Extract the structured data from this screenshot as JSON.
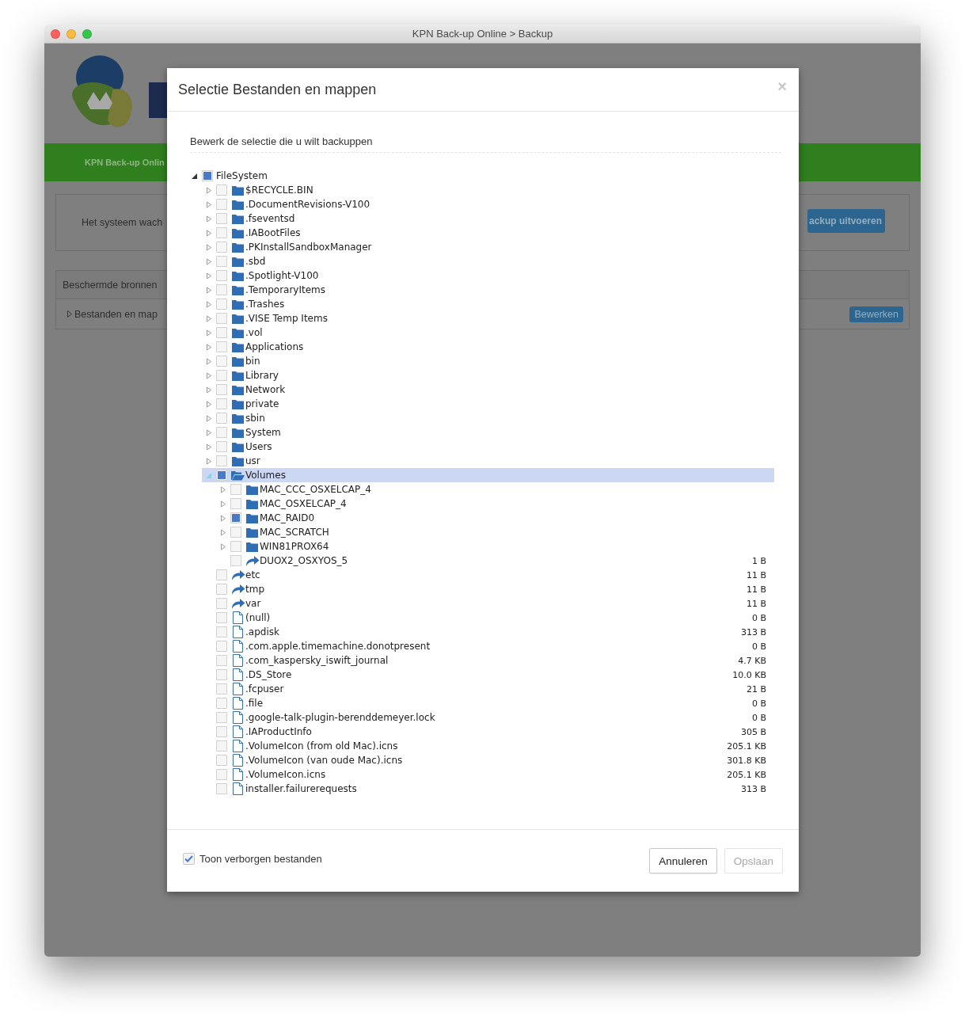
{
  "window": {
    "title": "KPN Back-up Online > Backup"
  },
  "background_page": {
    "nav_item": "KPN Back-up Onlin",
    "status_text": "Het systeem wach",
    "run_button": "ackup uitvoeren",
    "section_title": "Beschermde bronnen",
    "section_item": "Bestanden en map",
    "edit_button": "Bewerken"
  },
  "dialog": {
    "title": "Selectie Bestanden en mappen",
    "close": "×",
    "subtitle": "Bewerk de selectie die u wilt backuppen",
    "tree": [
      {
        "kind": "root",
        "name": "FileSystem",
        "expanded": true,
        "partial": true,
        "selected": false,
        "children": [
          {
            "kind": "folder",
            "name": "$RECYCLE.BIN",
            "expanded": false,
            "partial": false,
            "selected": false
          },
          {
            "kind": "folder",
            "name": ".DocumentRevisions-V100",
            "expanded": false,
            "partial": false,
            "selected": false
          },
          {
            "kind": "folder",
            "name": ".fseventsd",
            "expanded": false,
            "partial": false,
            "selected": false
          },
          {
            "kind": "folder",
            "name": ".IABootFiles",
            "expanded": false,
            "partial": false,
            "selected": false
          },
          {
            "kind": "folder",
            "name": ".PKInstallSandboxManager",
            "expanded": false,
            "partial": false,
            "selected": false
          },
          {
            "kind": "folder",
            "name": ".sbd",
            "expanded": false,
            "partial": false,
            "selected": false
          },
          {
            "kind": "folder",
            "name": ".Spotlight-V100",
            "expanded": false,
            "partial": false,
            "selected": false
          },
          {
            "kind": "folder",
            "name": ".TemporaryItems",
            "expanded": false,
            "partial": false,
            "selected": false
          },
          {
            "kind": "folder",
            "name": ".Trashes",
            "expanded": false,
            "partial": false,
            "selected": false
          },
          {
            "kind": "folder",
            "name": ".VISE Temp Items",
            "expanded": false,
            "partial": false,
            "selected": false
          },
          {
            "kind": "folder",
            "name": ".vol",
            "expanded": false,
            "partial": false,
            "selected": false
          },
          {
            "kind": "folder",
            "name": "Applications",
            "expanded": false,
            "partial": false,
            "selected": false
          },
          {
            "kind": "folder",
            "name": "bin",
            "expanded": false,
            "partial": false,
            "selected": false
          },
          {
            "kind": "folder",
            "name": "Library",
            "expanded": false,
            "partial": false,
            "selected": false
          },
          {
            "kind": "folder",
            "name": "Network",
            "expanded": false,
            "partial": false,
            "selected": false
          },
          {
            "kind": "folder",
            "name": "private",
            "expanded": false,
            "partial": false,
            "selected": false
          },
          {
            "kind": "folder",
            "name": "sbin",
            "expanded": false,
            "partial": false,
            "selected": false
          },
          {
            "kind": "folder",
            "name": "System",
            "expanded": false,
            "partial": false,
            "selected": false
          },
          {
            "kind": "folder",
            "name": "Users",
            "expanded": false,
            "partial": false,
            "selected": false
          },
          {
            "kind": "folder",
            "name": "usr",
            "expanded": false,
            "partial": false,
            "selected": false
          },
          {
            "kind": "folder",
            "name": "Volumes",
            "expanded": true,
            "partial": true,
            "selected": true,
            "children": [
              {
                "kind": "folder",
                "name": "MAC_CCC_OSXELCAP_4",
                "expanded": false,
                "partial": false,
                "selected": false
              },
              {
                "kind": "folder",
                "name": "MAC_OSXELCAP_4",
                "expanded": false,
                "partial": false,
                "selected": false
              },
              {
                "kind": "folder",
                "name": "MAC_RAID0",
                "expanded": false,
                "partial": true,
                "selected": false
              },
              {
                "kind": "folder",
                "name": "MAC_SCRATCH",
                "expanded": false,
                "partial": false,
                "selected": false
              },
              {
                "kind": "folder",
                "name": "WIN81PROX64",
                "expanded": false,
                "partial": false,
                "selected": false
              },
              {
                "kind": "link",
                "name": "DUOX2_OSXYOS_5",
                "size": "1 B",
                "partial": false,
                "selected": false
              }
            ]
          },
          {
            "kind": "link",
            "name": "etc",
            "size": "11 B",
            "partial": false,
            "selected": false
          },
          {
            "kind": "link",
            "name": "tmp",
            "size": "11 B",
            "partial": false,
            "selected": false
          },
          {
            "kind": "link",
            "name": "var",
            "size": "11 B",
            "partial": false,
            "selected": false
          },
          {
            "kind": "file",
            "name": "(null)",
            "size": "0 B",
            "partial": false,
            "selected": false
          },
          {
            "kind": "file",
            "name": ".apdisk",
            "size": "313 B",
            "partial": false,
            "selected": false
          },
          {
            "kind": "file",
            "name": ".com.apple.timemachine.donotpresent",
            "size": "0 B",
            "partial": false,
            "selected": false
          },
          {
            "kind": "file",
            "name": ".com_kaspersky_iswift_journal",
            "size": "4.7 KB",
            "partial": false,
            "selected": false
          },
          {
            "kind": "file",
            "name": ".DS_Store",
            "size": "10.0 KB",
            "partial": false,
            "selected": false
          },
          {
            "kind": "file",
            "name": ".fcpuser",
            "size": "21 B",
            "partial": false,
            "selected": false
          },
          {
            "kind": "file",
            "name": ".file",
            "size": "0 B",
            "partial": false,
            "selected": false
          },
          {
            "kind": "file",
            "name": ".google-talk-plugin-berenddemeyer.lock",
            "size": "0 B",
            "partial": false,
            "selected": false
          },
          {
            "kind": "file",
            "name": ".IAProductInfo",
            "size": "305 B",
            "partial": false,
            "selected": false
          },
          {
            "kind": "file",
            "name": ".VolumeIcon (from old Mac).icns",
            "size": "205.1 KB",
            "partial": false,
            "selected": false
          },
          {
            "kind": "file",
            "name": ".VolumeIcon (van oude Mac).icns",
            "size": "301.8 KB",
            "partial": false,
            "selected": false
          },
          {
            "kind": "file",
            "name": ".VolumeIcon.icns",
            "size": "205.1 KB",
            "partial": false,
            "selected": false
          },
          {
            "kind": "file",
            "name": "installer.failurerequests",
            "size": "313 B",
            "partial": false,
            "selected": false
          }
        ]
      }
    ],
    "show_hidden": {
      "label": "Toon verborgen bestanden",
      "checked": true
    },
    "buttons": [
      {
        "label": "Annuleren",
        "disabled": false
      },
      {
        "label": "Opslaan",
        "disabled": true
      }
    ]
  }
}
